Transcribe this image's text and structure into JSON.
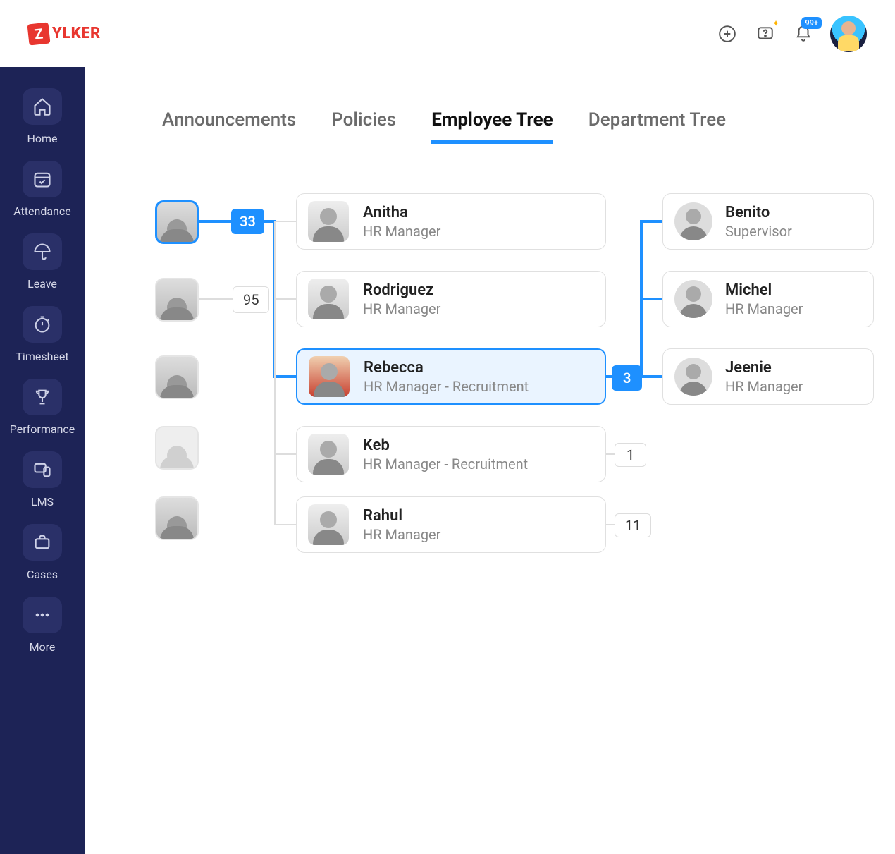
{
  "brand": {
    "badge": "Z",
    "name": "YLKER"
  },
  "header": {
    "notification_count": "99+"
  },
  "sidebar": {
    "items": [
      {
        "label": "Home"
      },
      {
        "label": "Attendance"
      },
      {
        "label": "Leave"
      },
      {
        "label": "Timesheet"
      },
      {
        "label": "Performance"
      },
      {
        "label": "LMS"
      },
      {
        "label": "Cases"
      },
      {
        "label": "More"
      }
    ]
  },
  "tabs": [
    {
      "label": "Announcements",
      "active": false
    },
    {
      "label": "Policies",
      "active": false
    },
    {
      "label": "Employee Tree",
      "active": true
    },
    {
      "label": "Department Tree",
      "active": false
    }
  ],
  "tree": {
    "root_count": "33",
    "sibling_count": "95",
    "mid": [
      {
        "name": "Anitha",
        "role": "HR Manager"
      },
      {
        "name": "Rodriguez",
        "role": "HR Manager"
      },
      {
        "name": "Rebecca",
        "role": "HR Manager - Recruitment",
        "selected": true,
        "child_count": "3"
      },
      {
        "name": "Keb",
        "role": "HR Manager - Recruitment",
        "child_count": "1"
      },
      {
        "name": "Rahul",
        "role": "HR Manager",
        "child_count": "11"
      }
    ],
    "right": [
      {
        "name": "Benito",
        "role": "Supervisor"
      },
      {
        "name": "Michel",
        "role": "HR Manager"
      },
      {
        "name": "Jeenie",
        "role": "HR Manager"
      }
    ]
  }
}
